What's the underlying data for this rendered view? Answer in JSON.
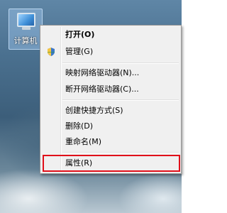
{
  "desktop": {
    "icon": {
      "name": "computer-icon",
      "label": "计算机"
    }
  },
  "context_menu": {
    "items": [
      {
        "label": "打开(O)",
        "bold": true
      },
      {
        "label": "管理(G)",
        "icon": "shield-icon"
      },
      {
        "label": "映射网络驱动器(N)..."
      },
      {
        "label": "断开网络驱动器(C)..."
      },
      {
        "label": "创建快捷方式(S)"
      },
      {
        "label": "删除(D)"
      },
      {
        "label": "重命名(M)"
      },
      {
        "label": "属性(R)",
        "highlighted": true
      }
    ]
  },
  "colors": {
    "highlight_border": "#e0101a",
    "menu_background": "#f0f0f0"
  }
}
